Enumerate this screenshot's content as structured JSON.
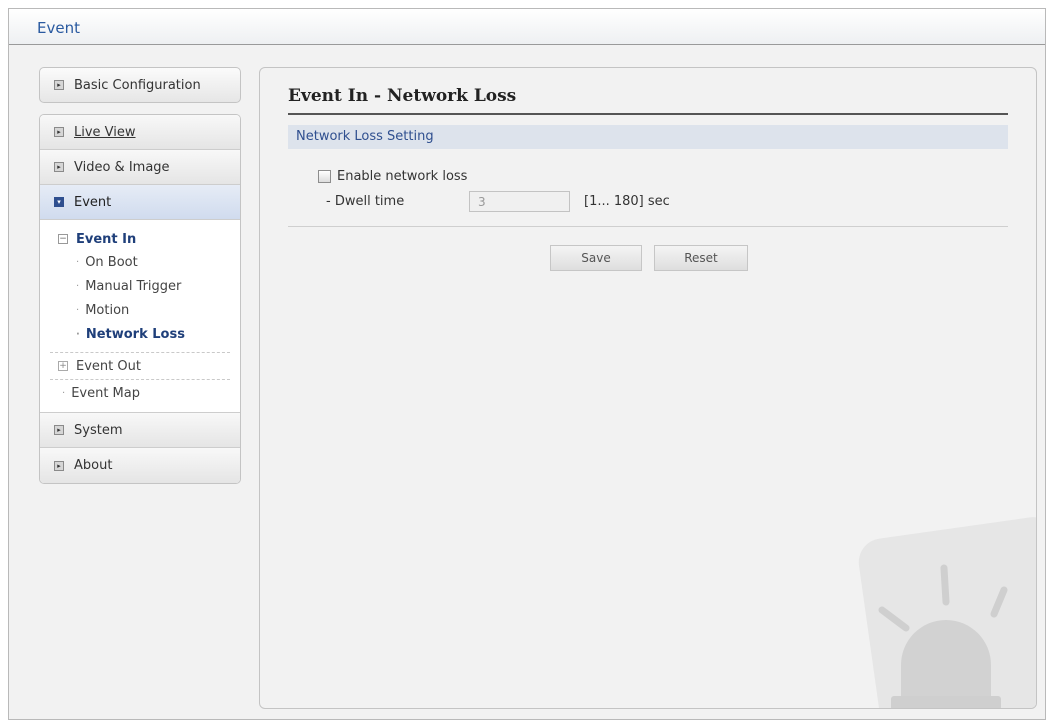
{
  "window": {
    "title": "Event"
  },
  "sidebar": {
    "basic_config": "Basic Configuration",
    "items": [
      {
        "label": "Live View"
      },
      {
        "label": "Video & Image"
      },
      {
        "label": "Event"
      }
    ],
    "event_in": {
      "label": "Event In",
      "items": [
        "On Boot",
        "Manual Trigger",
        "Motion",
        "Network Loss"
      ]
    },
    "event_out": "Event Out",
    "event_map": "Event Map",
    "system": "System",
    "about": "About"
  },
  "main": {
    "title": "Event In - Network Loss",
    "section": "Network Loss Setting",
    "enable_label": "Enable network loss",
    "enable_checked": false,
    "dwell_label": "- Dwell time",
    "dwell_value": "3",
    "dwell_range": "[1... 180] sec",
    "save_label": "Save",
    "reset_label": "Reset"
  },
  "colors": {
    "title_blue": "#2a5aa0",
    "active_blue": "#1f3f7a",
    "section_bg": "#dde3ec"
  }
}
